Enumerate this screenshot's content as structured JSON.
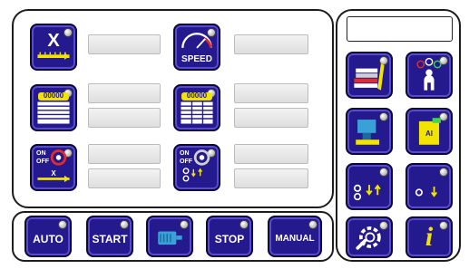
{
  "buttons": {
    "x_axis": {
      "label": "X",
      "icon": "x-axis-ruler-icon"
    },
    "speed": {
      "label": "SPEED",
      "icon": "speedometer-icon"
    },
    "counter_list": {
      "label": "00000",
      "icon": "counter-list-icon"
    },
    "counter_grid": {
      "label": "00000",
      "icon": "counter-grid-icon"
    },
    "on_off_x": {
      "on": "ON",
      "off": "OFF",
      "axis": "X",
      "icon": "on-off-axis-icon"
    },
    "on_off_cycle": {
      "on": "ON",
      "off": "OFF",
      "icon": "on-off-cycle-icon"
    },
    "auto": {
      "label": "AUTO"
    },
    "start": {
      "label": "START"
    },
    "motor": {
      "label": "",
      "icon": "motor-icon"
    },
    "stop": {
      "label": "STOP"
    },
    "manual": {
      "label": "MANUAL"
    },
    "manual_book": {
      "icon": "manual-book-icon"
    },
    "operator": {
      "icon": "operator-icon"
    },
    "machine": {
      "icon": "machine-icon"
    },
    "ai_module": {
      "label": "AI",
      "icon": "ai-module-icon"
    },
    "io_arrows": {
      "icon": "io-arrows-icon"
    },
    "io_single": {
      "icon": "io-single-icon"
    },
    "settings": {
      "icon": "settings-wrench-icon"
    },
    "info": {
      "label": "i",
      "icon": "info-icon"
    }
  },
  "colors": {
    "button_bg": "#241a8d",
    "button_border": "#0a0637",
    "accent_yellow": "#f2e400",
    "field_bg": "#e8e8e8"
  }
}
